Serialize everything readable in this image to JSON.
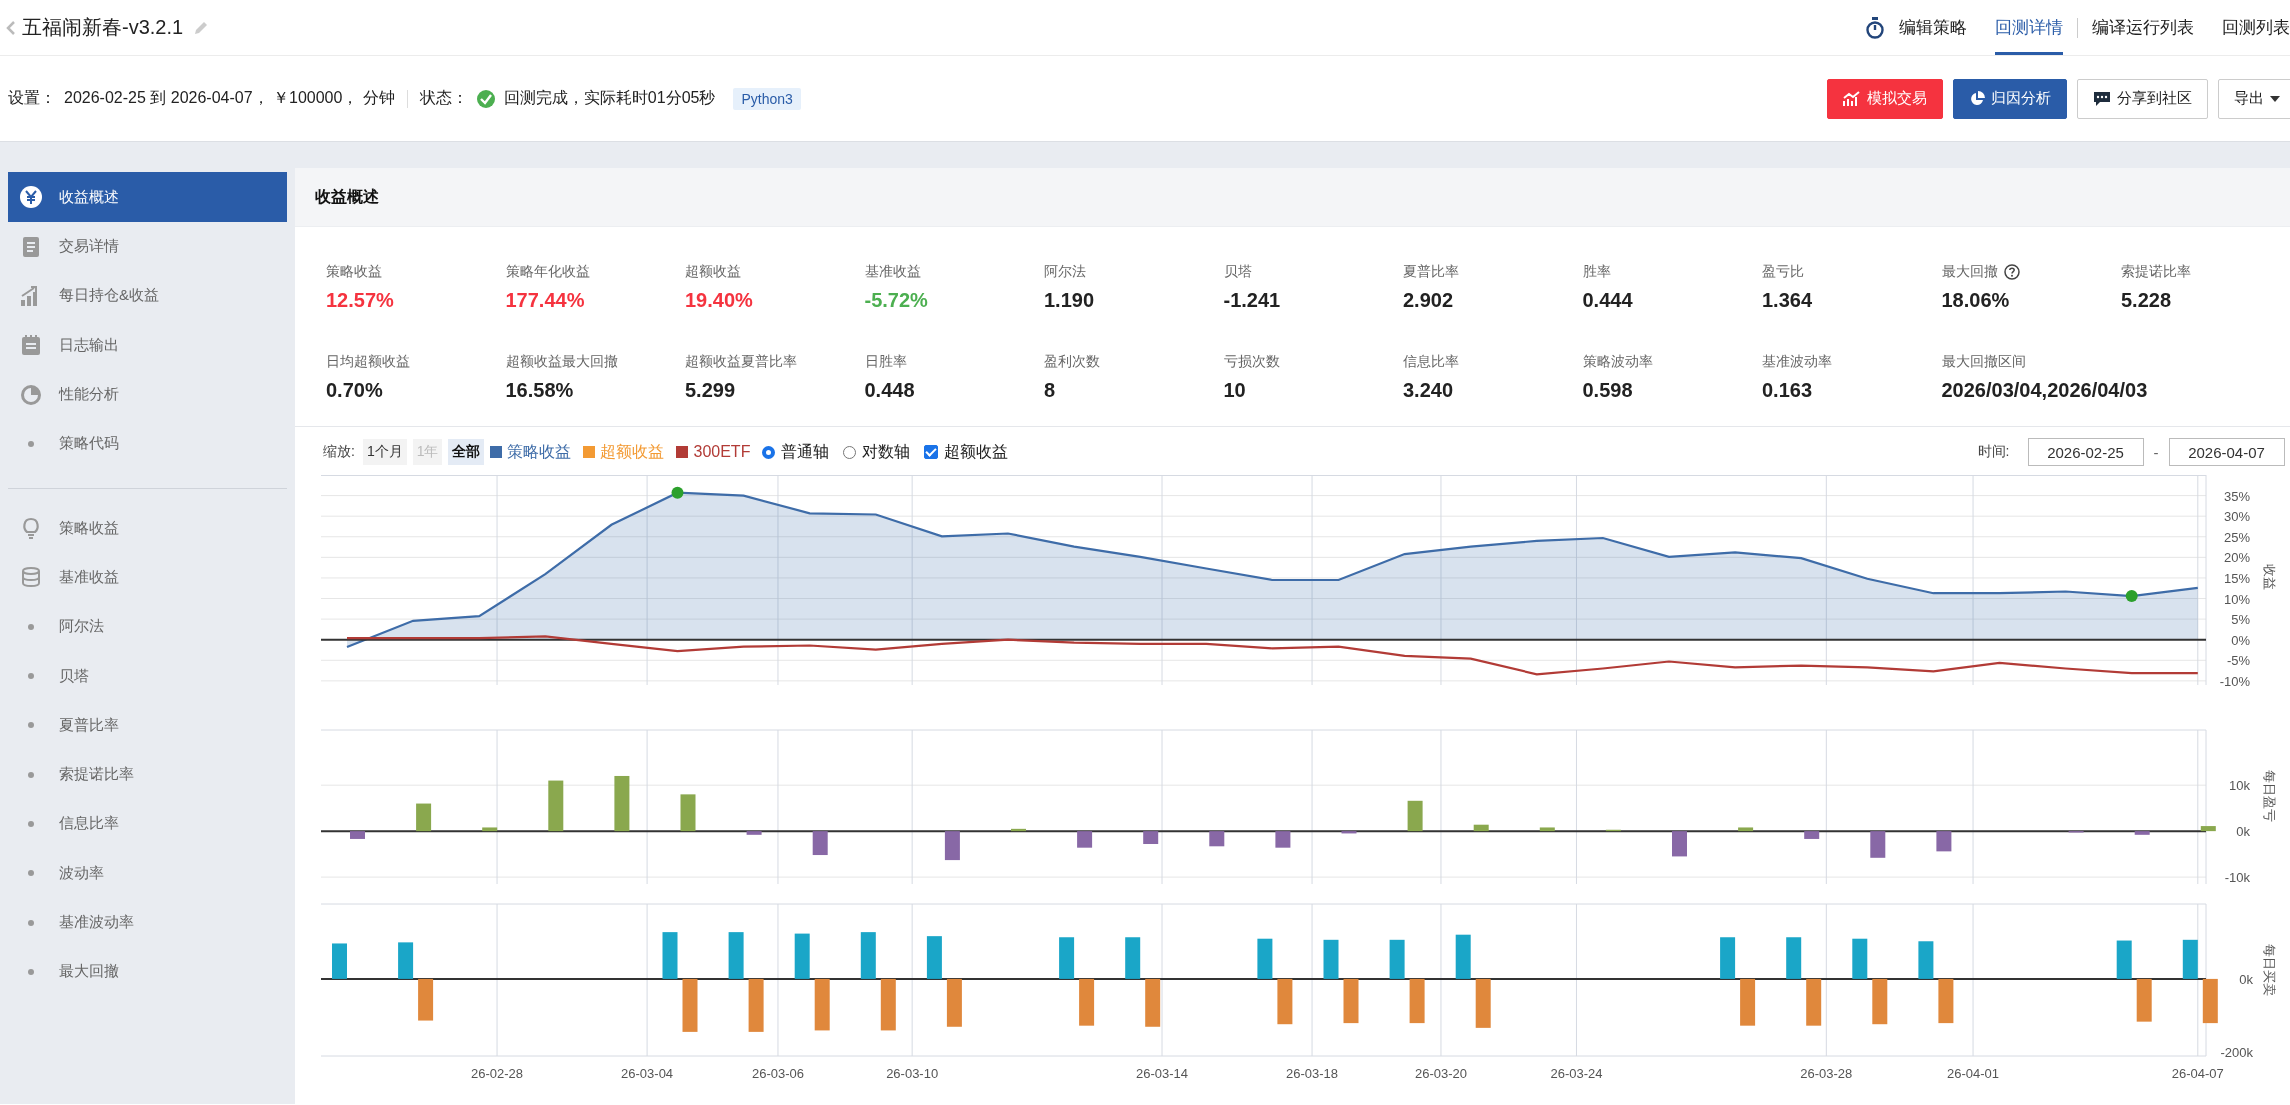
{
  "header": {
    "title": "五福闹新春-v3.2.1",
    "nav": [
      {
        "label": "编辑策略",
        "selected": false
      },
      {
        "label": "回测详情",
        "selected": true
      },
      {
        "label": "编译运行列表",
        "selected": false
      },
      {
        "label": "回测列表",
        "selected": false
      }
    ]
  },
  "settings": {
    "label": "设置：",
    "value": "2026-02-25 到 2026-04-07， ￥100000， 分钟",
    "status_label": "状态：",
    "status": "回测完成，实际耗时01分05秒",
    "language": "Python3"
  },
  "actions": [
    {
      "label": "模拟交易",
      "kind": "danger"
    },
    {
      "label": "归因分析",
      "kind": "primary"
    },
    {
      "label": "分享到社区",
      "kind": "plain"
    },
    {
      "label": "导出",
      "kind": "dropdown"
    }
  ],
  "sidebar": {
    "groups": [
      [
        {
          "label": "收益概述",
          "selected": true
        },
        {
          "label": "交易详情",
          "selected": false
        },
        {
          "label": "每日持仓&收益",
          "selected": false
        },
        {
          "label": "日志输出",
          "selected": false
        },
        {
          "label": "性能分析",
          "selected": false
        },
        {
          "label": "策略代码",
          "selected": false
        }
      ],
      [
        {
          "label": "策略收益",
          "selected": false
        },
        {
          "label": "基准收益",
          "selected": false
        },
        {
          "label": "阿尔法",
          "selected": false
        },
        {
          "label": "贝塔",
          "selected": false
        },
        {
          "label": "夏普比率",
          "selected": false
        },
        {
          "label": "索提诺比率",
          "selected": false
        },
        {
          "label": "信息比率",
          "selected": false
        },
        {
          "label": "波动率",
          "selected": false
        },
        {
          "label": "基准波动率",
          "selected": false
        },
        {
          "label": "最大回撤",
          "selected": false
        }
      ]
    ]
  },
  "overview": {
    "title": "收益概述",
    "metrics": [
      {
        "label": "策略收益",
        "value": "12.57%",
        "color": "#f5333f",
        "kind": "plain"
      },
      {
        "label": "策略年化收益",
        "value": "177.44%",
        "color": "#f5333f",
        "kind": "plain"
      },
      {
        "label": "超额收益",
        "value": "19.40%",
        "color": "#f5333f",
        "kind": "plain"
      },
      {
        "label": "基准收益",
        "value": "-5.72%",
        "color": "#4caf50",
        "kind": "plain"
      },
      {
        "label": "阿尔法",
        "value": "1.190",
        "color": "#222222",
        "kind": "plain"
      },
      {
        "label": "贝塔",
        "value": "-1.241",
        "color": "#222222",
        "kind": "plain"
      },
      {
        "label": "夏普比率",
        "value": "2.902",
        "color": "#222222",
        "kind": "plain"
      },
      {
        "label": "胜率",
        "value": "0.444",
        "color": "#222222",
        "kind": "plain"
      },
      {
        "label": "盈亏比",
        "value": "1.364",
        "color": "#222222",
        "kind": "plain"
      },
      {
        "label": "最大回撤",
        "value": "18.06%",
        "color": "#222222",
        "kind": "help"
      },
      {
        "label": "索提诺比率",
        "value": "5.228",
        "color": "#222222",
        "kind": "plain"
      },
      {
        "label": "日均超额收益",
        "value": "0.70%",
        "color": "#222222",
        "kind": "plain"
      },
      {
        "label": "超额收益最大回撤",
        "value": "16.58%",
        "color": "#222222",
        "kind": "plain"
      },
      {
        "label": "超额收益夏普比率",
        "value": "5.299",
        "color": "#222222",
        "kind": "plain"
      },
      {
        "label": "日胜率",
        "value": "0.448",
        "color": "#222222",
        "kind": "plain"
      },
      {
        "label": "盈利次数",
        "value": "8",
        "color": "#222222",
        "kind": "plain"
      },
      {
        "label": "亏损次数",
        "value": "10",
        "color": "#222222",
        "kind": "plain"
      },
      {
        "label": "信息比率",
        "value": "3.240",
        "color": "#222222",
        "kind": "plain"
      },
      {
        "label": "策略波动率",
        "value": "0.598",
        "color": "#222222",
        "kind": "plain"
      },
      {
        "label": "基准波动率",
        "value": "0.163",
        "color": "#222222",
        "kind": "plain"
      },
      {
        "label": "最大回撤区间",
        "value": "2026/03/04,2026/04/03",
        "color": "#222222",
        "kind": "plain"
      }
    ]
  },
  "chart_controls": {
    "zoom_label": "缩放:",
    "zoom": [
      {
        "label": "1个月",
        "selected": false,
        "disabled": false
      },
      {
        "label": "1年",
        "selected": false,
        "disabled": true
      },
      {
        "label": "全部",
        "selected": true,
        "disabled": false
      }
    ],
    "legend": [
      {
        "label": "策略收益",
        "color": "#3e6ca8"
      },
      {
        "label": "超额收益",
        "color": "#f39a33"
      },
      {
        "label": "300ETF",
        "color": "#b23b36"
      }
    ],
    "axis": [
      {
        "label": "普通轴",
        "selected": true
      },
      {
        "label": "对数轴",
        "selected": false
      }
    ],
    "excess": {
      "label": "超额收益",
      "checked": true
    },
    "time_label": "时间:",
    "start": "2026-02-25",
    "range_separator": "-",
    "end": "2026-04-07"
  },
  "charts": [
    {
      "chart_data": {
        "type": "line",
        "ylabel": "收益",
        "grid": true,
        "ylim": [
          -11,
          40
        ],
        "yticks": [
          {
            "value": 35,
            "label": "35%"
          },
          {
            "value": 30,
            "label": "30%"
          },
          {
            "value": 25,
            "label": "25%"
          },
          {
            "value": 20,
            "label": "20%"
          },
          {
            "value": 15,
            "label": "15%"
          },
          {
            "value": 10,
            "label": "10%"
          },
          {
            "value": 5,
            "label": "5%"
          },
          {
            "value": 0,
            "label": "0%"
          },
          {
            "value": -5,
            "label": "-5%"
          },
          {
            "value": -10,
            "label": "-10%"
          }
        ],
        "series": [
          {
            "color": "#3e6ca8",
            "values": [
              -1.8,
              4.6,
              5.7,
              15.9,
              27.9,
              35.7,
              35.0,
              30.7,
              30.4,
              25.1,
              25.8,
              22.6,
              20.1,
              17.3,
              14.5,
              14.5,
              20.8,
              22.6,
              24.0,
              24.7,
              20.1,
              21.2,
              19.8,
              14.8,
              11.3,
              11.3,
              11.7,
              10.6,
              12.6
            ]
          },
          {
            "color": "#b23b36",
            "values": [
              0.4,
              0.4,
              0.4,
              0.8,
              -1.0,
              -2.8,
              -1.7,
              -1.4,
              -2.4,
              -1.0,
              0,
              -0.7,
              -1.0,
              -1.0,
              -2.1,
              -1.7,
              -3.9,
              -4.6,
              -8.4,
              -7.0,
              -5.3,
              -6.7,
              -6.3,
              -6.7,
              -7.7,
              -5.6,
              -7.0,
              -8.1,
              -8.1
            ]
          }
        ]
      }
    },
    {
      "chart_data": {
        "type": "bar",
        "ylabel": "每日盈亏",
        "grid": true,
        "ylim": [
          -11500,
          22000
        ],
        "yticks": [
          {
            "value": 10000,
            "label": "10k"
          },
          {
            "value": 0,
            "label": "0k"
          },
          {
            "value": -10000,
            "label": "-10k"
          }
        ],
        "series": [
          {
            "color": "#8aa84e",
            "values": [
              null,
              6000,
              800,
              11000,
              12000,
              8000,
              null,
              null,
              null,
              null,
              500,
              null,
              null,
              null,
              null,
              null,
              6600,
              1400,
              800,
              300,
              null,
              800,
              null,
              null,
              null,
              null,
              null,
              null,
              1100
            ]
          },
          {
            "color": "#8868a6",
            "values": [
              -1700,
              null,
              null,
              null,
              null,
              null,
              -800,
              -5200,
              null,
              -6300,
              null,
              -3600,
              -2800,
              -3300,
              -3600,
              -500,
              null,
              null,
              null,
              null,
              -5500,
              null,
              -1700,
              -5800,
              -4400,
              null,
              -300,
              -800,
              null
            ]
          }
        ]
      }
    },
    {
      "date_labels": [
        "26-02-28",
        "26-03-04",
        "26-03-06",
        "26-03-10",
        "26-03-14",
        "26-03-18",
        "26-03-20",
        "26-03-24",
        "26-03-28",
        "26-04-01",
        "26-04-07"
      ],
      "chart_data": {
        "type": "bar",
        "ylabel": "每日买卖",
        "grid": true,
        "ylim": [
          -211000,
          205000
        ],
        "yticks": [
          {
            "value": 0,
            "label": "0k"
          },
          {
            "value": -200000,
            "label": "-200k"
          }
        ],
        "series": [
          {
            "color": "#1aa6c8",
            "values": [
              97000,
              100000,
              null,
              null,
              null,
              128000,
              128000,
              124000,
              128000,
              117000,
              null,
              114000,
              114000,
              null,
              110000,
              107000,
              107000,
              121000,
              null,
              null,
              null,
              114000,
              114000,
              110000,
              103000,
              null,
              null,
              105000,
              107000
            ]
          },
          {
            "color": "#e0883c",
            "values": [
              null,
              -114000,
              null,
              null,
              null,
              -145000,
              -145000,
              -141000,
              -141000,
              -131000,
              null,
              -128000,
              -131000,
              null,
              -124000,
              -121000,
              -121000,
              -134000,
              null,
              null,
              null,
              -128000,
              -128000,
              -124000,
              -121000,
              null,
              null,
              -117000,
              -121000
            ]
          }
        ]
      }
    }
  ]
}
